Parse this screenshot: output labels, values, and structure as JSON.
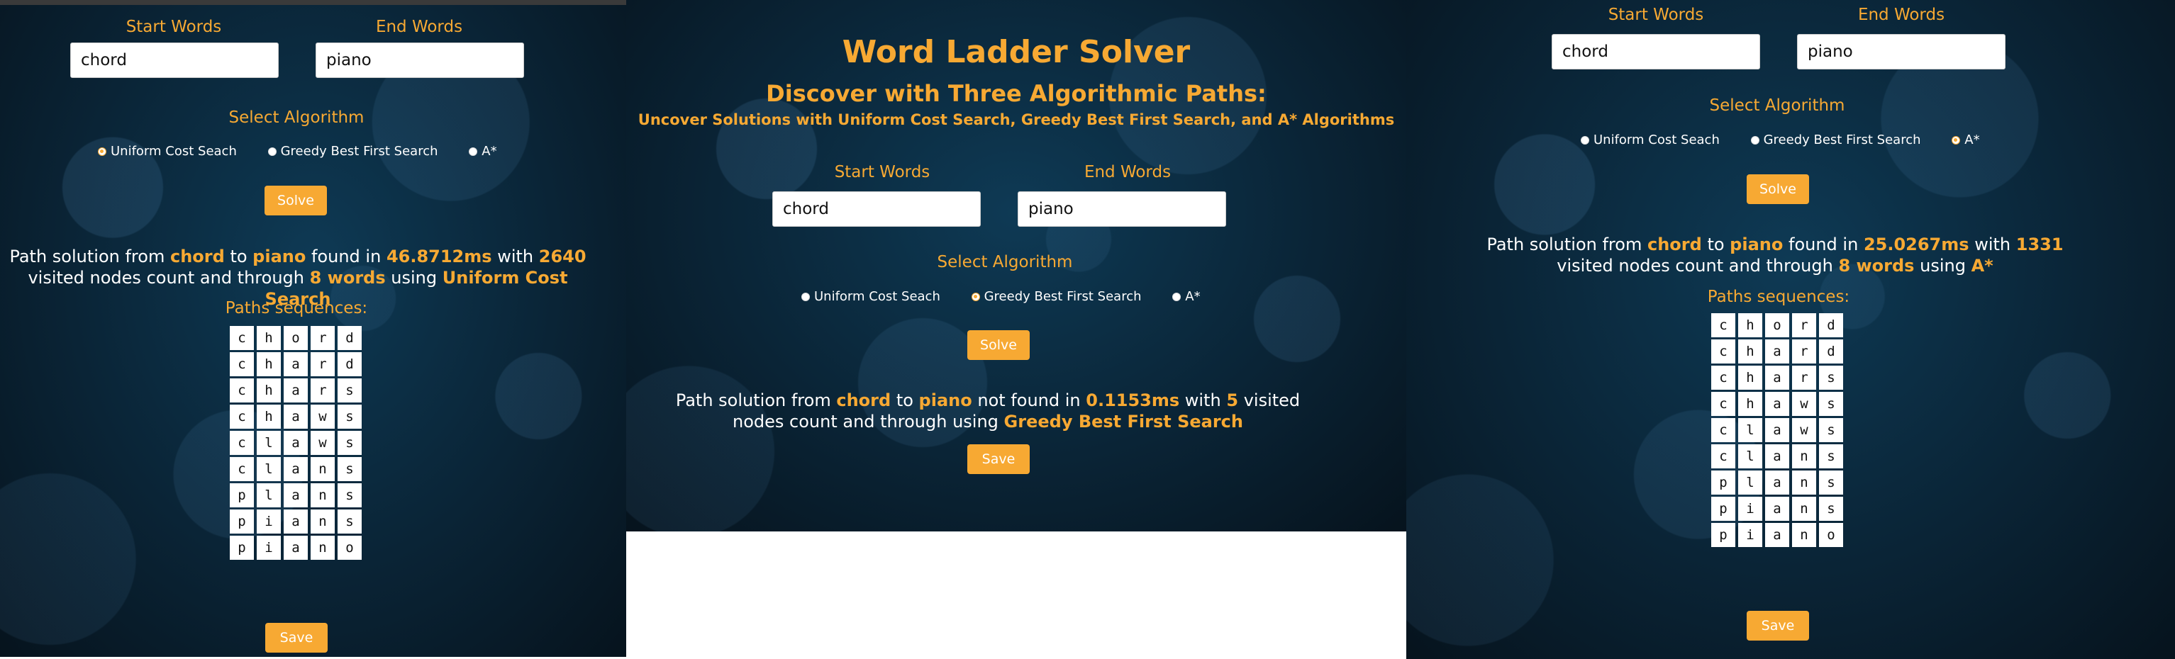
{
  "panel1": {
    "start_label": "Start Words",
    "end_label": "End Words",
    "start_value": "chord",
    "end_value": "piano",
    "algorithm_label": "Select Algorithm",
    "options": [
      "Uniform Cost Seach",
      "Greedy Best First Search",
      "A*"
    ],
    "selected": 0,
    "solve_label": "Solve",
    "result": {
      "prefix": "Path solution from",
      "from": "chord",
      "to_word": "to",
      "to": "piano",
      "found": "found in",
      "time": "46.8712ms",
      "with": "with",
      "count": "2640",
      "mid": "visited nodes count and through",
      "words": "8 words",
      "using": "using",
      "algorithm": "Uniform Cost Search"
    },
    "paths_label": "Paths sequences:",
    "paths": [
      "chord",
      "chard",
      "chars",
      "chaws",
      "claws",
      "clans",
      "plans",
      "pians",
      "piano"
    ],
    "save_label": "Save"
  },
  "panel2": {
    "title": "Word Ladder Solver",
    "subtitle": "Discover with Three Algorithmic Paths:",
    "tagline": "Uncover Solutions with Uniform Cost Search, Greedy Best First Search, and A* Algorithms",
    "start_label": "Start Words",
    "end_label": "End Words",
    "start_value": "chord",
    "end_value": "piano",
    "algorithm_label": "Select Algorithm",
    "options": [
      "Uniform Cost Seach",
      "Greedy Best First Search",
      "A*"
    ],
    "selected": 1,
    "solve_label": "Solve",
    "result": {
      "prefix": "Path solution from",
      "from": "chord",
      "to_word": "to",
      "to": "piano",
      "found": "not found in",
      "time": "0.1153ms",
      "with": "with",
      "count": "5",
      "mid": "visited nodes count and through using",
      "algorithm": "Greedy Best First Search"
    },
    "save_label": "Save"
  },
  "panel3": {
    "start_label": "Start Words",
    "end_label": "End Words",
    "start_value": "chord",
    "end_value": "piano",
    "algorithm_label": "Select Algorithm",
    "options": [
      "Uniform Cost Seach",
      "Greedy Best First Search",
      "A*"
    ],
    "selected": 2,
    "solve_label": "Solve",
    "result": {
      "prefix": "Path solution from",
      "from": "chord",
      "to_word": "to",
      "to": "piano",
      "found": "found in",
      "time": "25.0267ms",
      "with": "with",
      "count": "1331",
      "mid": "visited nodes count and through",
      "words": "8 words",
      "using": "using",
      "algorithm": "A*"
    },
    "paths_label": "Paths sequences:",
    "paths": [
      "chord",
      "chard",
      "chars",
      "chaws",
      "claws",
      "clans",
      "plans",
      "pians",
      "piano"
    ],
    "save_label": "Save"
  },
  "colors": {
    "accent": "#f7a933",
    "background": "#0a2436"
  },
  "icons": {
    "radio_off": "radio-unchecked-icon",
    "radio_on": "radio-checked-icon"
  }
}
